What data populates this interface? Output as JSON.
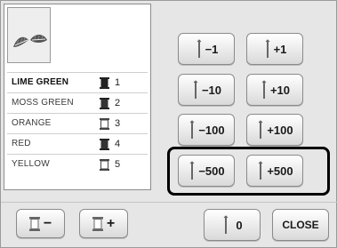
{
  "colors": [
    {
      "name": "LIME GREEN",
      "number": "1",
      "selected": true
    },
    {
      "name": "MOSS GREEN",
      "number": "2",
      "selected": false
    },
    {
      "name": "ORANGE",
      "number": "3",
      "selected": false
    },
    {
      "name": "RED",
      "number": "4",
      "selected": false
    },
    {
      "name": "YELLOW",
      "number": "5",
      "selected": false
    }
  ],
  "moves": {
    "minus_1": "−1",
    "plus_1": "+1",
    "minus_10": "−10",
    "plus_10": "+10",
    "minus_100": "−100",
    "plus_100": "+100",
    "minus_500": "−500",
    "plus_500": "+500"
  },
  "bottom": {
    "spool_minus": "−",
    "spool_plus": "+",
    "zero_label": "0",
    "close_label": "CLOSE"
  },
  "icons": {
    "needle": "needle-icon",
    "spool": "thread-spool-icon",
    "preview": "embroidery-pattern-preview"
  }
}
